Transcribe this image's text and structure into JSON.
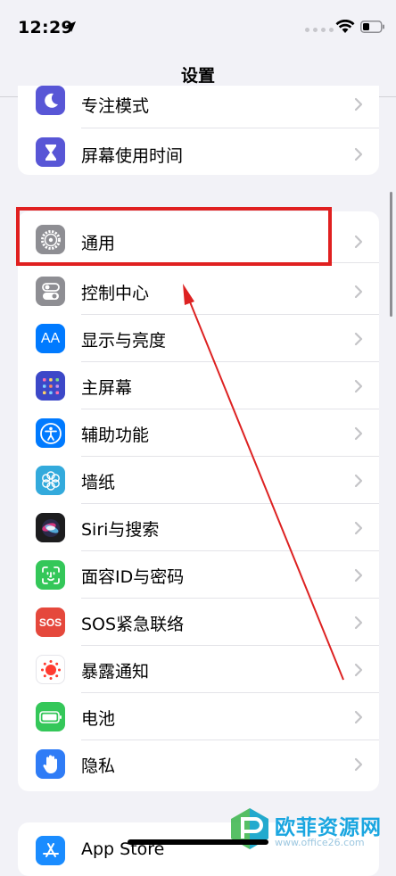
{
  "status_bar": {
    "time": "12:29"
  },
  "nav": {
    "title": "设置"
  },
  "top_group": [
    {
      "label": "专注模式",
      "icon": "moon-icon",
      "color": "#5856d6"
    },
    {
      "label": "屏幕使用时间",
      "icon": "hourglass-icon",
      "color": "#5856d6"
    }
  ],
  "main_group": [
    {
      "label": "通用",
      "icon": "gear-icon",
      "color": "#8e8e93"
    },
    {
      "label": "控制中心",
      "icon": "toggles-icon",
      "color": "#8e8e93"
    },
    {
      "label": "显示与亮度",
      "icon": "text-size-icon",
      "color": "#007aff"
    },
    {
      "label": "主屏幕",
      "icon": "home-grid-icon",
      "color": "#3c48c8"
    },
    {
      "label": "辅助功能",
      "icon": "accessibility-icon",
      "color": "#007aff"
    },
    {
      "label": "墙纸",
      "icon": "flower-icon",
      "color": "#33aadc"
    },
    {
      "label": "Siri与搜索",
      "icon": "siri-icon",
      "color": "#1c1c1e"
    },
    {
      "label": "面容ID与密码",
      "icon": "face-id-icon",
      "color": "#34c759"
    },
    {
      "label": "SOS紧急联络",
      "icon": "sos-icon",
      "color": "#e5483c"
    },
    {
      "label": "暴露通知",
      "icon": "exposure-icon",
      "color": "#ffffff"
    },
    {
      "label": "电池",
      "icon": "battery-icon",
      "color": "#34c759"
    },
    {
      "label": "隐私",
      "icon": "hand-icon",
      "color": "#2f7cf6"
    }
  ],
  "bottom_group": [
    {
      "label": "App Store",
      "icon": "app-store-icon",
      "color": "#1a8cff"
    }
  ],
  "sos_text": "SOS",
  "text_size_glyph": "AA",
  "watermark": {
    "text": "欧菲资源网",
    "sub": "www.office26.com"
  },
  "annotation": {
    "highlight_color": "#e02020"
  }
}
